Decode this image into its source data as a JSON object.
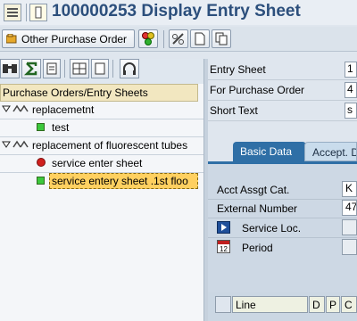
{
  "title": "100000253 Display Entry Sheet",
  "app_toolbar": {
    "other_po_label": "Other Purchase Order"
  },
  "tree": {
    "header": "Purchase Orders/Entry Sheets",
    "items": [
      {
        "label": "replacemetnt",
        "level": 0
      },
      {
        "label": "test",
        "level": 1,
        "status": "green"
      },
      {
        "label": "replacement of fluorescent tubes",
        "level": 0
      },
      {
        "label": "service enter sheet",
        "level": 1,
        "status": "red"
      },
      {
        "label": "service entery sheet .1st floo",
        "level": 1,
        "status": "green",
        "selected": true
      }
    ]
  },
  "header_fields": {
    "entry_sheet_label": "Entry Sheet",
    "entry_sheet_value": "1",
    "for_po_label": "For Purchase Order",
    "for_po_value": "4",
    "short_text_label": "Short Text",
    "short_text_value": "s"
  },
  "tabs": {
    "basic": "Basic Data",
    "accept": "Accept. D"
  },
  "basic_data": {
    "acct_assgt_label": "Acct Assgt Cat.",
    "acct_assgt_value": "K",
    "external_number_label": "External Number",
    "external_number_value": "47",
    "service_loc_label": "Service Loc.",
    "period_label": "Period"
  },
  "grid": {
    "col_line": "Line",
    "col_d": "D",
    "col_p": "P",
    "col_c": "C"
  },
  "colors": {
    "title": "#2c4f7c",
    "tab_active": "#2f6fa6",
    "selected_row": "#ffd060"
  }
}
